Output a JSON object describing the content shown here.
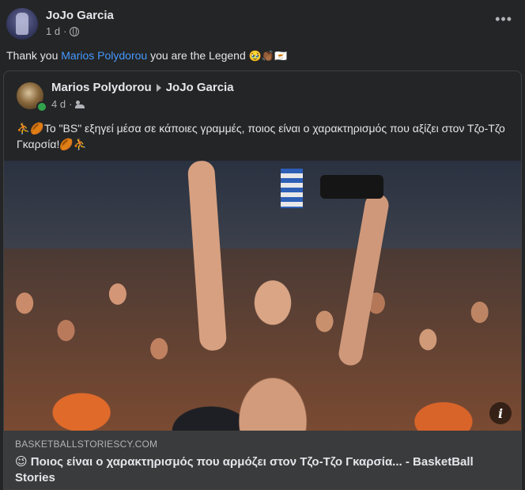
{
  "post": {
    "author": "JoJo Garcia",
    "time": "1 d",
    "separator": "·",
    "more_label": "•••",
    "caption": {
      "prefix": "Thank you ",
      "mention": "Marios Polydorou",
      "suffix": " you are the Legend",
      "emojis": "🥹👏🏾🇨🇾"
    }
  },
  "shared": {
    "author": "Marios Polydorou",
    "target": "JoJo Garcia",
    "time": "4 d",
    "separator": "·",
    "text": "⛹️🏉Το \"BS\" εξηγεί μέσα σε κάποιες γραμμές, ποιος είναι ο χαρακτηρισμός που αξίζει στον Τζο-Τζο Γκαρσία!🏉⛹️",
    "info_label": "i",
    "link": {
      "domain": "BASKETBALLSTORIESCY.COM",
      "title": "😉 Ποιος είναι ο χαρακτηρισμός που αρμόζει στον Τζο-Τζο Γκαρσία... - BasketBall Stories"
    }
  },
  "colors": {
    "background": "#242526",
    "text_primary": "#e4e6eb",
    "text_secondary": "#b0b3b8",
    "mention_link": "#4599ff",
    "online": "#31a24c",
    "preview_bg": "#3a3b3c"
  },
  "icons": [
    "globe-icon",
    "friends-icon",
    "more-icon",
    "info-icon",
    "triangle-arrow-icon"
  ]
}
